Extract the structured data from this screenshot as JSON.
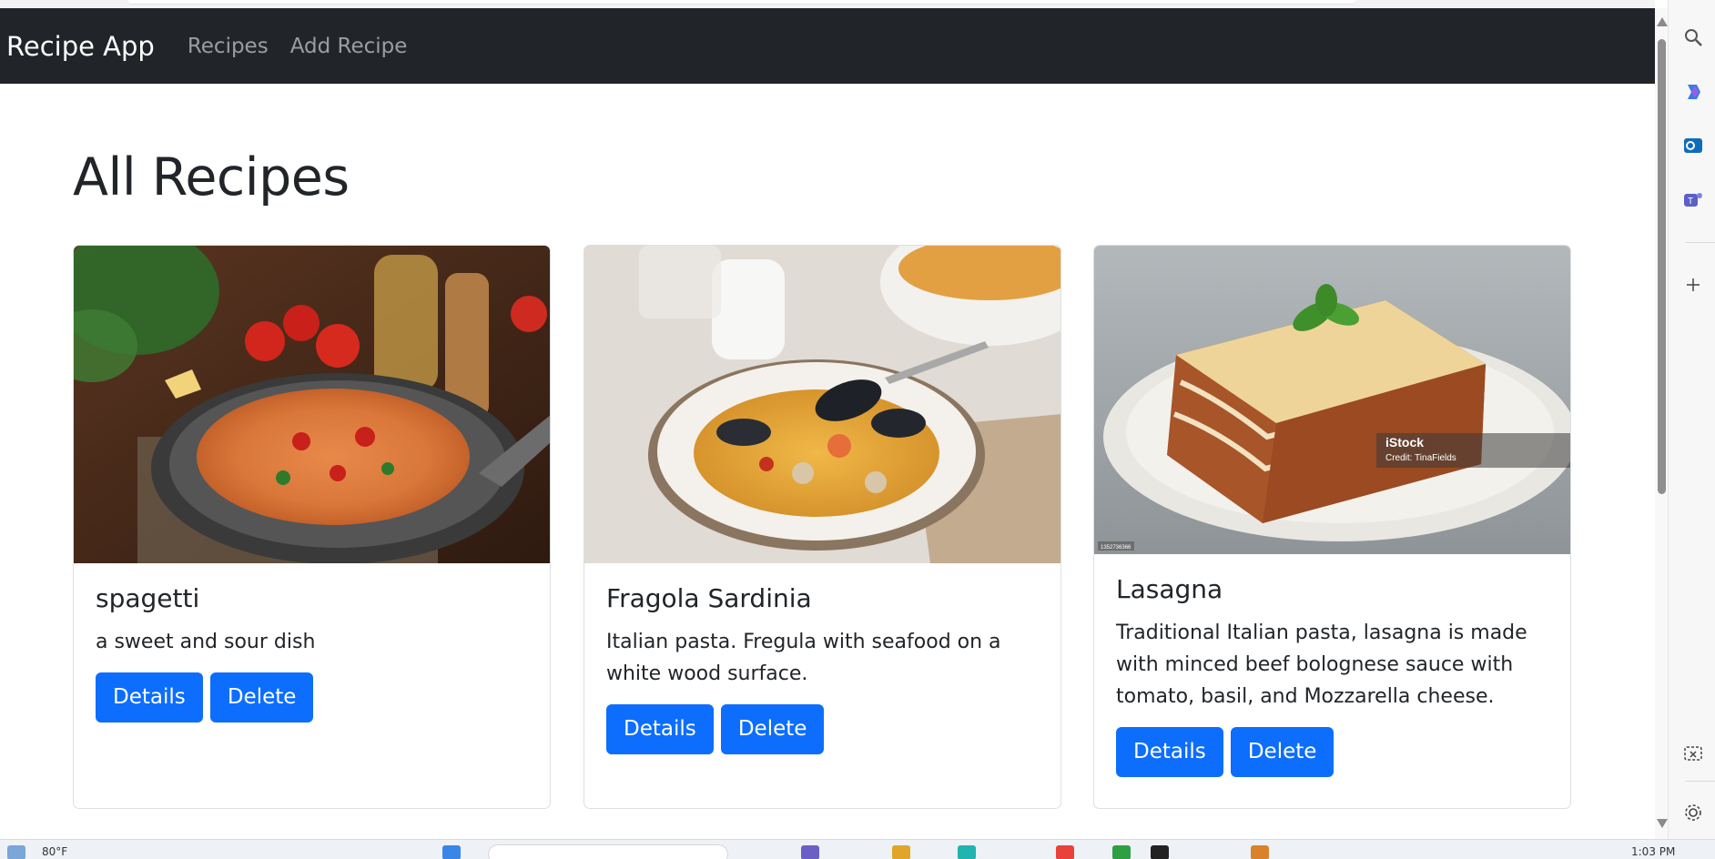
{
  "navbar": {
    "brand": "Recipe App",
    "links": [
      "Recipes",
      "Add Recipe"
    ]
  },
  "page": {
    "title": "All Recipes"
  },
  "recipes": [
    {
      "title": "spagetti",
      "description": "a sweet and sour dish",
      "details_label": "Details",
      "delete_label": "Delete"
    },
    {
      "title": "Fragola Sardinia",
      "description": "Italian pasta. Fregula with seafood on a white wood surface.",
      "details_label": "Details",
      "delete_label": "Delete"
    },
    {
      "title": "Lasagna",
      "description": "Traditional Italian pasta, lasagna is made with minced beef bolognese sauce with tomato, basil, and Mozzarella cheese.",
      "details_label": "Details",
      "delete_label": "Delete",
      "image_watermark": "iStock",
      "image_credit": "Credit: TinaFields",
      "image_id": "1352736366"
    }
  ],
  "taskbar": {
    "weather": "80°F",
    "time": "1:03 PM"
  },
  "colors": {
    "navbar_bg": "#212529",
    "primary": "#0d6efd",
    "card_border": "#dcdfe3"
  },
  "edge_icons": [
    "search-icon",
    "copilot-icon",
    "outlook-icon",
    "teams-icon",
    "add-icon",
    "screenshot-icon",
    "settings-icon"
  ]
}
